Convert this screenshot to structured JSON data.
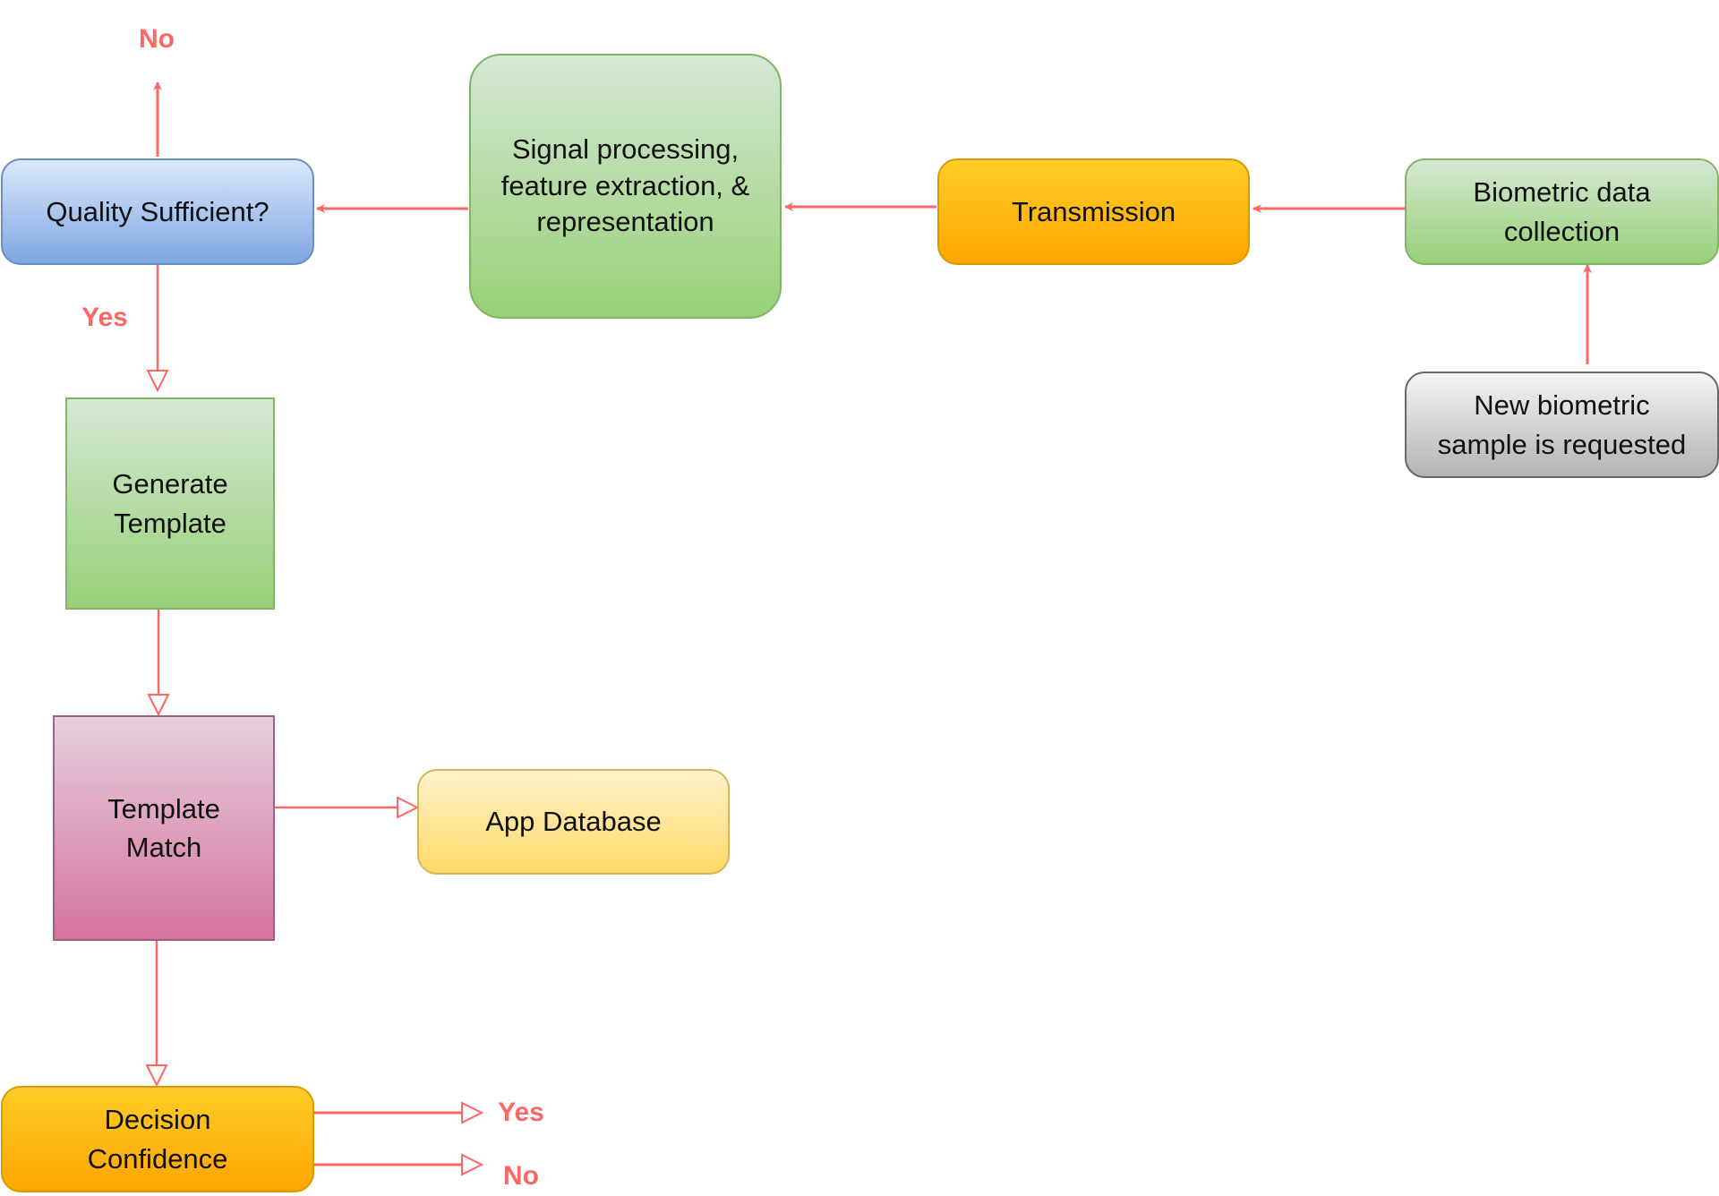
{
  "diagram": {
    "type": "flowchart",
    "edge_color": "#ff6666",
    "nodes": [
      {
        "id": "quality",
        "label": "Quality  Sufficient?",
        "style": "blue"
      },
      {
        "id": "signal",
        "label": "Signal processing,\nfeature extraction, &\nrepresentation",
        "style": "green"
      },
      {
        "id": "transmission",
        "label": "Transmission",
        "style": "orange"
      },
      {
        "id": "collection",
        "label": "Biometric data\ncollection",
        "style": "green"
      },
      {
        "id": "request",
        "label": "New biometric\nsample is requested",
        "style": "gray"
      },
      {
        "id": "generate",
        "label": "Generate\nTemplate",
        "style": "green"
      },
      {
        "id": "match",
        "label": "Template\nMatch",
        "style": "pink"
      },
      {
        "id": "database",
        "label": "App Database",
        "style": "yellow"
      },
      {
        "id": "decision",
        "label": "Decision\nConfidence",
        "style": "orange"
      }
    ],
    "edges": [
      {
        "from": "request",
        "to": "collection",
        "label": ""
      },
      {
        "from": "collection",
        "to": "transmission",
        "label": ""
      },
      {
        "from": "transmission",
        "to": "signal",
        "label": ""
      },
      {
        "from": "signal",
        "to": "quality",
        "label": ""
      },
      {
        "from": "quality",
        "to": "out-no",
        "label": "No"
      },
      {
        "from": "quality",
        "to": "generate",
        "label": "Yes"
      },
      {
        "from": "generate",
        "to": "match",
        "label": ""
      },
      {
        "from": "match",
        "to": "database",
        "label": ""
      },
      {
        "from": "match",
        "to": "decision",
        "label": ""
      },
      {
        "from": "decision",
        "to": "out-yes",
        "label": "Yes"
      },
      {
        "from": "decision",
        "to": "out-no-2",
        "label": "No"
      }
    ],
    "labels": {
      "quality_no": "No",
      "quality_yes": "Yes",
      "decision_yes": "Yes",
      "decision_no": "No"
    }
  }
}
